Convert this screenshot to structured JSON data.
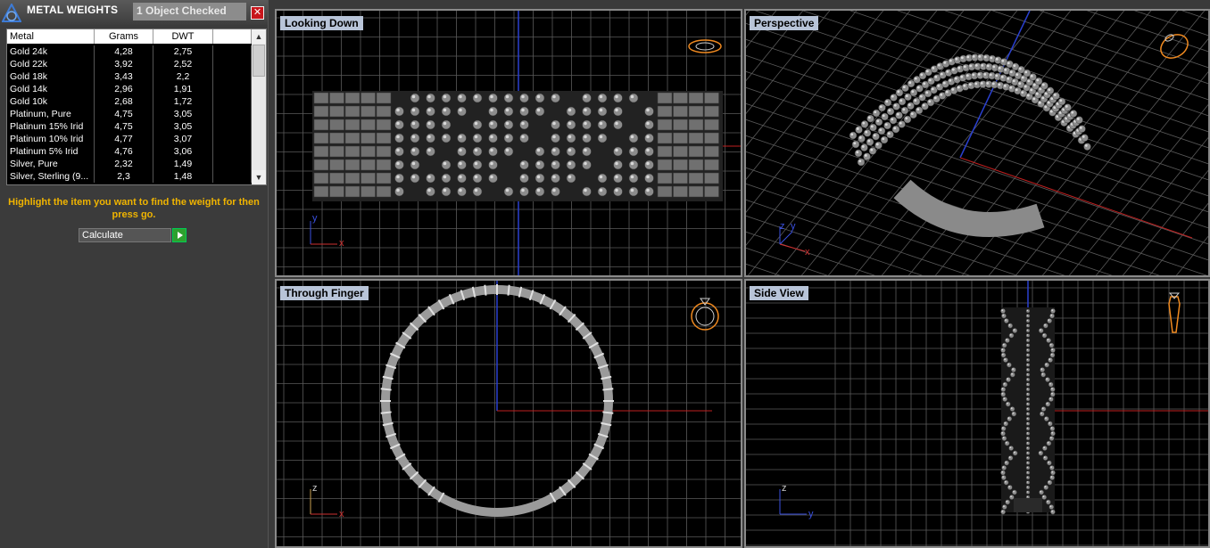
{
  "panel": {
    "title": "METAL WEIGHTS",
    "status": "1 Object Checked",
    "close_glyph": "✕",
    "columns": [
      "Metal",
      "Grams",
      "DWT",
      ""
    ],
    "rows": [
      {
        "metal": "Gold 24k",
        "grams": "4,28",
        "dwt": "2,75"
      },
      {
        "metal": "Gold 22k",
        "grams": "3,92",
        "dwt": "2,52"
      },
      {
        "metal": "Gold 18k",
        "grams": "3,43",
        "dwt": "2,2"
      },
      {
        "metal": "Gold 14k",
        "grams": "2,96",
        "dwt": "1,91"
      },
      {
        "metal": "Gold 10k",
        "grams": "2,68",
        "dwt": "1,72"
      },
      {
        "metal": "Platinum, Pure",
        "grams": "4,75",
        "dwt": "3,05"
      },
      {
        "metal": "Platinum 15% Irid",
        "grams": "4,75",
        "dwt": "3,05"
      },
      {
        "metal": "Platinum 10% Irid",
        "grams": "4,77",
        "dwt": "3,07"
      },
      {
        "metal": "Platinum 5% Irid",
        "grams": "4,76",
        "dwt": "3,06"
      },
      {
        "metal": "Silver, Pure",
        "grams": "2,32",
        "dwt": "1,49"
      },
      {
        "metal": "Silver, Sterling (9...",
        "grams": "2,3",
        "dwt": "1,48"
      }
    ],
    "hint": "Highlight the item you want to find the weight for then press go.",
    "calculate_label": "Calculate",
    "accent": "#f0b400",
    "go_color": "#2ea02e"
  },
  "viewports": {
    "top_left": {
      "label": "Looking Down",
      "axis_a": "y",
      "axis_b": "x"
    },
    "top_right": {
      "label": "Perspective",
      "axis_a": "z",
      "axis_b": "y",
      "axis_c": "x"
    },
    "bottom_left": {
      "label": "Through Finger",
      "axis_a": "z",
      "axis_b": "x"
    },
    "bottom_right": {
      "label": "Side View",
      "axis_a": "z",
      "axis_b": "y"
    }
  },
  "icons": [
    "app-logo-icon",
    "close-icon",
    "scroll-up-icon",
    "scroll-down-icon",
    "go-arrow-icon",
    "ring-orientation-icon"
  ]
}
